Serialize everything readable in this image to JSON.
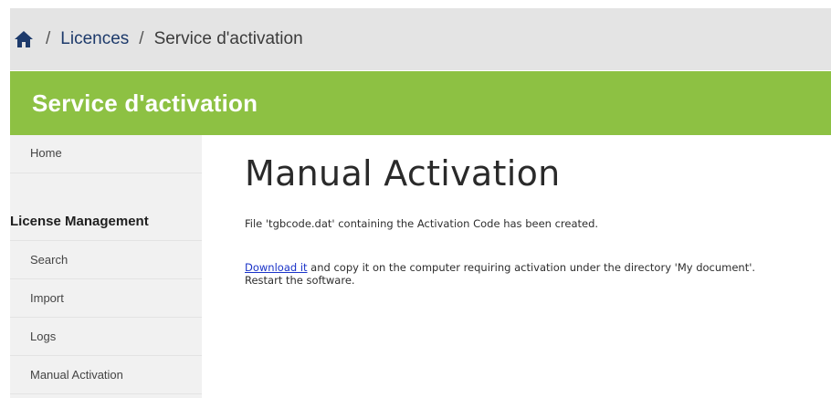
{
  "breadcrumb": {
    "home_icon": "home-icon",
    "separator": "/",
    "licences": "Licences",
    "current": "Service d'activation"
  },
  "banner": {
    "title": "Service d'activation"
  },
  "sidebar": {
    "home": "Home",
    "section_title": "License Management",
    "items": [
      {
        "label": "Search"
      },
      {
        "label": "Import"
      },
      {
        "label": "Logs"
      },
      {
        "label": "Manual Activation"
      }
    ]
  },
  "main": {
    "title": "Manual Activation",
    "message_created": "File 'tgbcode.dat' containing the Activation Code has been created.",
    "download_link": "Download it",
    "download_rest": " and copy it on the computer requiring activation under the directory 'My document'.",
    "restart": "Restart the software."
  },
  "colors": {
    "banner": "#8dc143",
    "breadcrumb_bg": "#e4e4e4",
    "sidebar_bg": "#f1f1f1",
    "link": "#1a33c8",
    "nav_link": "#1d3a6b"
  }
}
